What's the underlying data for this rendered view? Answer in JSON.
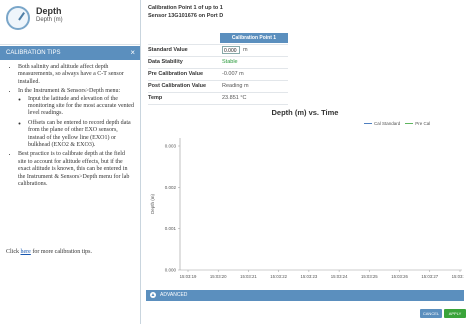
{
  "sensor": {
    "name": "Depth",
    "unit": "Depth (m)",
    "icon": "gauge-icon"
  },
  "tips_header": {
    "title": "CALIBRATION TIPS",
    "close": "×"
  },
  "tips": {
    "item1": "Both salinity and altitude affect depth measurements, so always have a C-T sensor installed.",
    "item2": "In the Instrument & Sensors>Depth menu:",
    "sub1": "Input the latitude and elevation of the monitoring site for the most accurate vented level readings.",
    "sub2": "Offsets can be entered to record depth data from the plane of other EXO sensors, instead of the yellow line (EXO1) or bulkhead (EXO2 & EXO3).",
    "item3": "Best practice is to calibrate depth at the field site to account for altitude effects, but if the exact altitude is known, this can be entered in the Instrument & Sensors>Depth menu for lab calibrations.",
    "more_prefix": "Click ",
    "more_link": "here",
    "more_suffix": " for more calibration tips."
  },
  "calibration": {
    "line1": "Calibration Point 1 of up to 1",
    "line2": "Sensor 13G101676 on Port D",
    "tab": "Calibration Point 1",
    "rows": {
      "standard_label": "Standard Value",
      "standard_value": "0.000",
      "standard_unit": "m",
      "stability_label": "Data Stability",
      "stability_value": "Stable",
      "pre_label": "Pre Calibration Value",
      "pre_value": "-0.007 m",
      "post_label": "Post Calibration Value",
      "post_value": "Reading m",
      "temp_label": "Temp",
      "temp_value": "23.851 °C"
    }
  },
  "chart_data": {
    "type": "line",
    "title": "Depth (m) vs. Time",
    "ylabel": "Depth (m)",
    "xlabel": "",
    "ylim": [
      0.0,
      0.003
    ],
    "yticks": [
      "0.003",
      "0.002",
      "0.001",
      "0.000"
    ],
    "xticks": [
      "15:03:19",
      "15:03:20",
      "15:03:21",
      "15:03:22",
      "15:03:23",
      "15:03:24",
      "15:03:25",
      "15:03:26",
      "15:03:27",
      "15:03:28"
    ],
    "grid": false,
    "legend_placement": "top-right",
    "series": [
      {
        "name": "Cal Standard",
        "color": "#4f7fc0",
        "values": []
      },
      {
        "name": "Pre Cal",
        "color": "#5fb55f",
        "values": []
      }
    ]
  },
  "advanced": {
    "label": "ADVANCED",
    "icon": "chevron-up-icon"
  },
  "footer": {
    "cancel": "CANCEL",
    "apply": "APPLY"
  },
  "colors": {
    "accent": "#5b8fbe",
    "apply": "#3aa43a",
    "stable": "#2a9a3c"
  }
}
